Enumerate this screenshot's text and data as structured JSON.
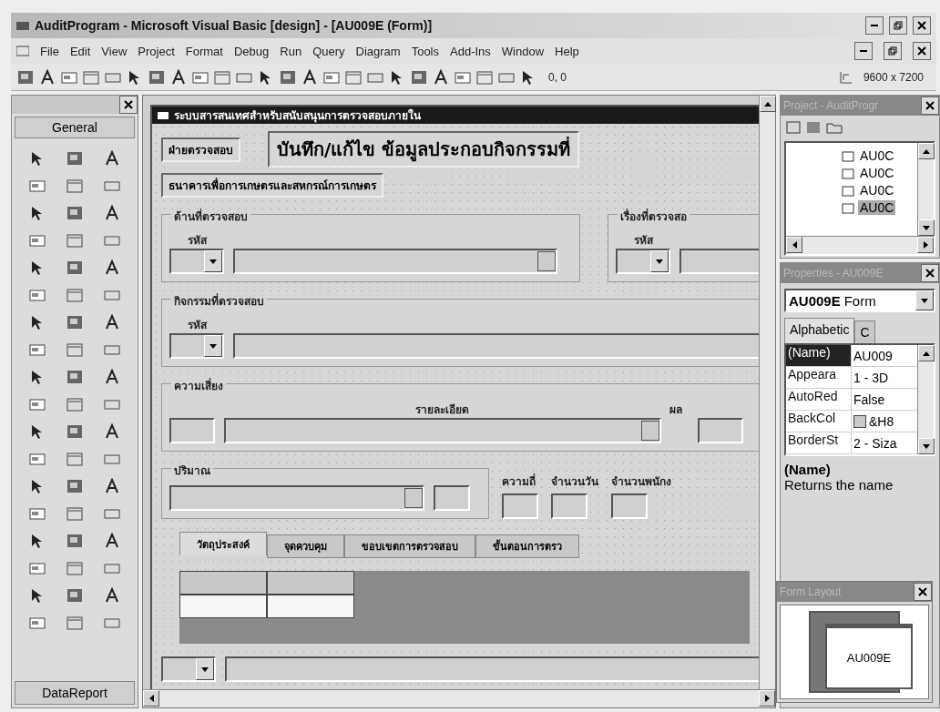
{
  "window": {
    "title": "AuditProgram - Microsoft Visual Basic [design] - [AU009E (Form)]"
  },
  "menu": [
    "File",
    "Edit",
    "View",
    "Project",
    "Format",
    "Debug",
    "Run",
    "Query",
    "Diagram",
    "Tools",
    "Add-Ins",
    "Window",
    "Help"
  ],
  "toolbar": {
    "position": "0, 0",
    "size": "9600 x 7200"
  },
  "toolbox": {
    "tab": "General",
    "footer": "DataReport"
  },
  "form": {
    "title": "ระบบสารสนเทศสำหรับสนับสนุนการตรวจสอบภายใน",
    "department": "ฝ่ายตรวจสอบ",
    "heading": "บันทึก/แก้ไข ข้อมูลประกอบกิจกรรมที่",
    "bank": "ธนาคารเพื่อการเกษตรและสหกรณ์การเกษตร",
    "area": {
      "label": "ด้านที่ตรวจสอบ",
      "code": "รหัส"
    },
    "subject": {
      "label": "เรื่องที่ตรวจสอ",
      "code": "รหัส"
    },
    "activity": {
      "label": "กิจกรรมที่ตรวจสอบ",
      "code": "รหัส"
    },
    "risk": {
      "label": "ความเสี่ยง",
      "detail": "รายละเอียด",
      "result": "ผล"
    },
    "quantity": {
      "label": "ปริมาณ",
      "frequency": "ความถี่",
      "days": "จำนวนวัน",
      "staff": "จำนวนพนักง"
    },
    "tabs": [
      {
        "label": "วัตถุประสงค์",
        "selected": true
      },
      {
        "label": "จุดควบคุม",
        "selected": false
      },
      {
        "label": "ขอบเขตการตรวจสอบ",
        "selected": false
      },
      {
        "label": "ขั้นตอนการตรว",
        "selected": false
      }
    ]
  },
  "project": {
    "title": "Project - AuditProgr",
    "items": [
      {
        "label": "AU0C",
        "selected": false
      },
      {
        "label": "AU0C",
        "selected": false
      },
      {
        "label": "AU0C",
        "selected": false
      },
      {
        "label": "AU0C",
        "selected": true
      }
    ]
  },
  "properties": {
    "title": "Properties - AU009E",
    "object_name": "AU009E",
    "object_type": "Form",
    "tabs": [
      {
        "label": "Alphabetic",
        "selected": true
      },
      {
        "label": "C",
        "selected": false
      }
    ],
    "rows": [
      {
        "name": "(Name)",
        "value": "AU009",
        "selected": true,
        "kind": "text"
      },
      {
        "name": "Appeara",
        "value": "1 - 3D",
        "selected": false,
        "kind": "text"
      },
      {
        "name": "AutoRed",
        "value": "False",
        "selected": false,
        "kind": "text"
      },
      {
        "name": "BackCol",
        "value": "&H8",
        "selected": false,
        "kind": "color",
        "color": "#c8c8c8"
      },
      {
        "name": "BorderSt",
        "value": "2 - Siza",
        "selected": false,
        "kind": "text"
      }
    ],
    "description_title": "(Name)",
    "description": "Returns the name"
  },
  "form_layout": {
    "title": "Form Layout",
    "form": "AU009E"
  }
}
